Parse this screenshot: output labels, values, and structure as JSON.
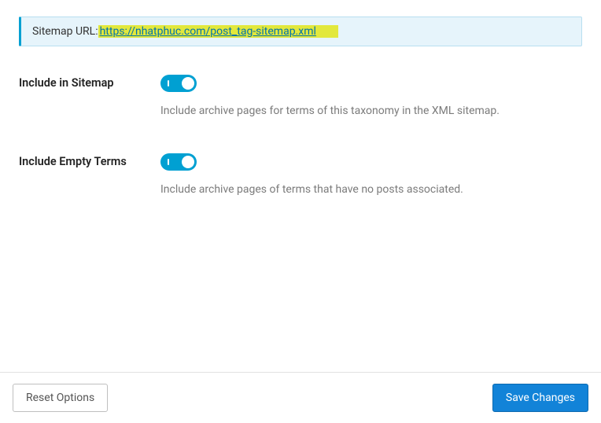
{
  "notice": {
    "label": "Sitemap URL:",
    "link_text": "https://nhatphuc.com/post_tag-sitemap.xml"
  },
  "settings": {
    "include_in_sitemap": {
      "label": "Include in Sitemap",
      "description": "Include archive pages for terms of this taxonomy in the XML sitemap."
    },
    "include_empty_terms": {
      "label": "Include Empty Terms",
      "description": "Include archive pages of terms that have no posts associated."
    }
  },
  "footer": {
    "reset": "Reset Options",
    "save": "Save Changes"
  }
}
